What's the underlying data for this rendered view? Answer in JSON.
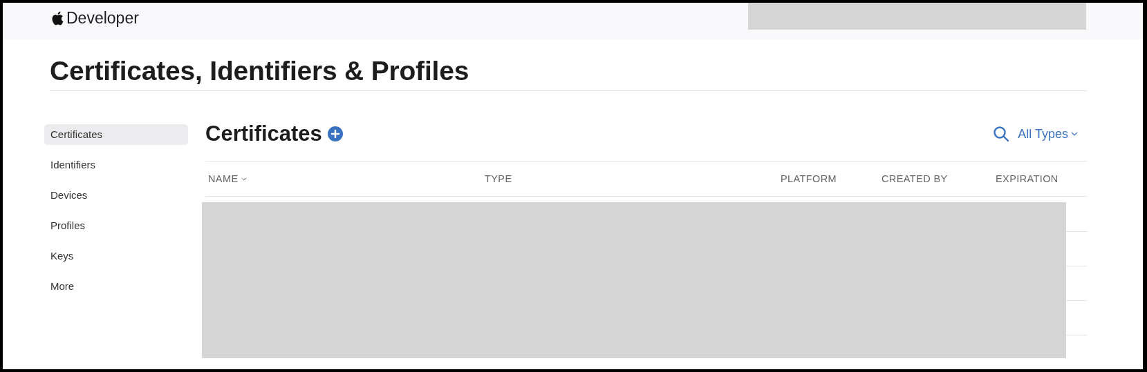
{
  "nav": {
    "brand": "Developer"
  },
  "page_title": "Certificates, Identifiers & Profiles",
  "sidebar": {
    "items": [
      {
        "label": "Certificates",
        "selected": true
      },
      {
        "label": "Identifiers",
        "selected": false
      },
      {
        "label": "Devices",
        "selected": false
      },
      {
        "label": "Profiles",
        "selected": false
      },
      {
        "label": "Keys",
        "selected": false
      },
      {
        "label": "More",
        "selected": false
      }
    ]
  },
  "section": {
    "title": "Certificates",
    "filter": "All Types"
  },
  "table": {
    "columns": [
      {
        "label": "NAME",
        "sortable": true
      },
      {
        "label": "TYPE",
        "sortable": false
      },
      {
        "label": "PLATFORM",
        "sortable": false
      },
      {
        "label": "CREATED BY",
        "sortable": false
      },
      {
        "label": "EXPIRATION",
        "sortable": false
      }
    ]
  }
}
